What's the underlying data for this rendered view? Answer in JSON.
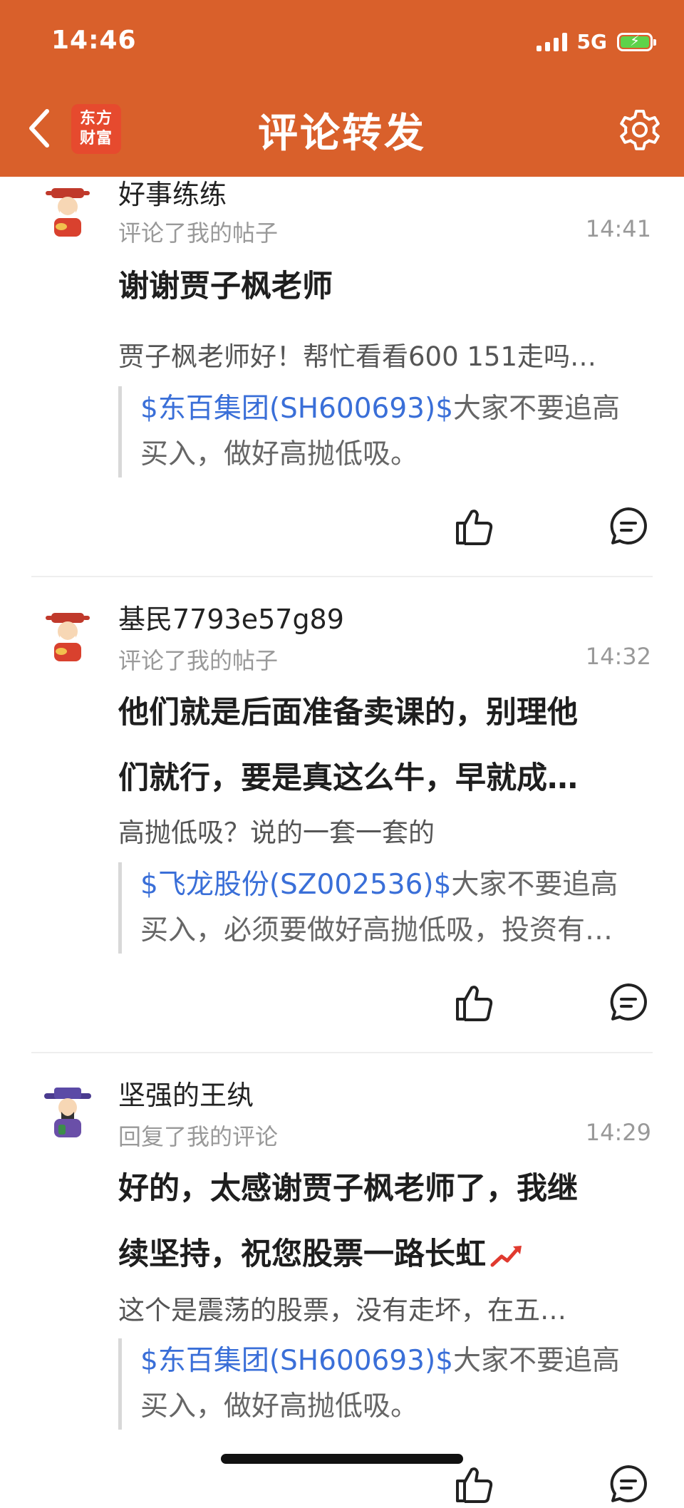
{
  "status_bar": {
    "time": "14:46",
    "network": "5G"
  },
  "header": {
    "title": "评论转发",
    "logo_line1": "东方",
    "logo_line2": "财富"
  },
  "items": [
    {
      "username": "好事练练",
      "action": "评论了我的帖子",
      "time": "14:41",
      "comment_lines": [
        "谢谢贾子枫老师"
      ],
      "reply_text": "贾子枫老师好！帮忙看看600 151走吗…",
      "quote_link": "$东百集团(SH600693)$",
      "quote_line1_rest": "大家不要追高",
      "quote_line2": "买入，做好高抛低吸。"
    },
    {
      "username": "基民7793e57g89",
      "action": "评论了我的帖子",
      "time": "14:32",
      "comment_lines": [
        "他们就是后面准备卖课的，别理他",
        "们就行，要是真这么牛，早就成…"
      ],
      "reply_text": "高抛低吸？说的一套一套的",
      "quote_link": "$飞龙股份(SZ002536)$",
      "quote_line1_rest": "大家不要追高",
      "quote_line2": "买入，必须要做好高抛低吸，投资有…"
    },
    {
      "username": "坚强的王纨",
      "action": "回复了我的评论",
      "time": "14:29",
      "comment_lines": [
        "好的，太感谢贾子枫老师了，我继",
        "续坚持，祝您股票一路长虹"
      ],
      "reply_text": "这个是震荡的股票，没有走坏，在五…",
      "quote_link": "$东百集团(SH600693)$",
      "quote_line1_rest": "大家不要追高",
      "quote_line2": "买入，做好高抛低吸。"
    }
  ],
  "icons": {
    "back": "chevron-left-icon",
    "settings": "gear-icon",
    "like": "thumbs-up-icon",
    "reply": "comment-bubble-icon",
    "trend": "trend-up-icon"
  },
  "colors": {
    "header_bg": "#d9602b",
    "link": "#3a6fd8",
    "muted": "#999999"
  }
}
